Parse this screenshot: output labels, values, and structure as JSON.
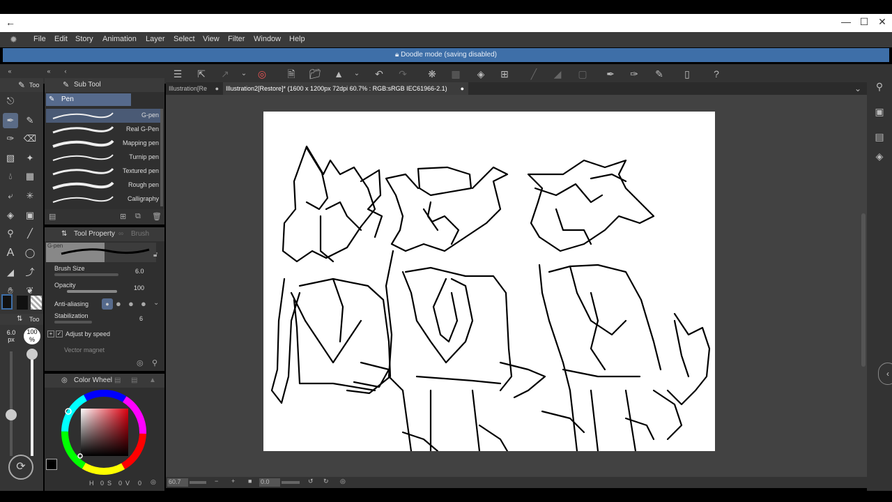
{
  "menu": [
    "File",
    "Edit",
    "Story",
    "Animation",
    "Layer",
    "Select",
    "View",
    "Filter",
    "Window",
    "Help"
  ],
  "doodle": {
    "text": "Doodle mode (saving disabled)"
  },
  "tabs": [
    {
      "label": "Illustration[Re"
    },
    {
      "label": "Illustration2[Restore]* (1600 x 1200px 72dpi 60.7% : RGB:sRGB IEC61966-2.1)"
    }
  ],
  "left_panel": {
    "tab_label": "Too",
    "tool_label_small": "Too"
  },
  "subtool": {
    "header": "Sub Tool",
    "group": "Pen",
    "brushes": [
      "G-pen",
      "Real G-Pen",
      "Mapping pen",
      "Turnip pen",
      "Textured pen",
      "Rough pen",
      "Calligraphy"
    ]
  },
  "tool_property": {
    "header": "Tool Property",
    "header2": "Brush Size",
    "preview_label": "G-pen",
    "brush_size_label": "Brush Size",
    "brush_size_value": "6.0",
    "opacity_label": "Opacity",
    "opacity_value": "100",
    "antialias_label": "Anti-aliasing",
    "stabilization_label": "Stabilization",
    "stabilization_value": "6",
    "adjust_label": "Adjust by speed",
    "vector_label": "Vector magnet"
  },
  "size_indicator": {
    "size": "6.0",
    "unit": "px",
    "opacity": "100",
    "opacity_unit": "%"
  },
  "color_wheel": {
    "header": "Color Wheel",
    "values": [
      "0",
      "0",
      "0"
    ],
    "main_color": "#000000"
  },
  "status": {
    "zoom": "60.7",
    "angle": "0.0"
  },
  "colors": {
    "accent": "#3e6fa8",
    "active_tool": "#5a6b86"
  }
}
